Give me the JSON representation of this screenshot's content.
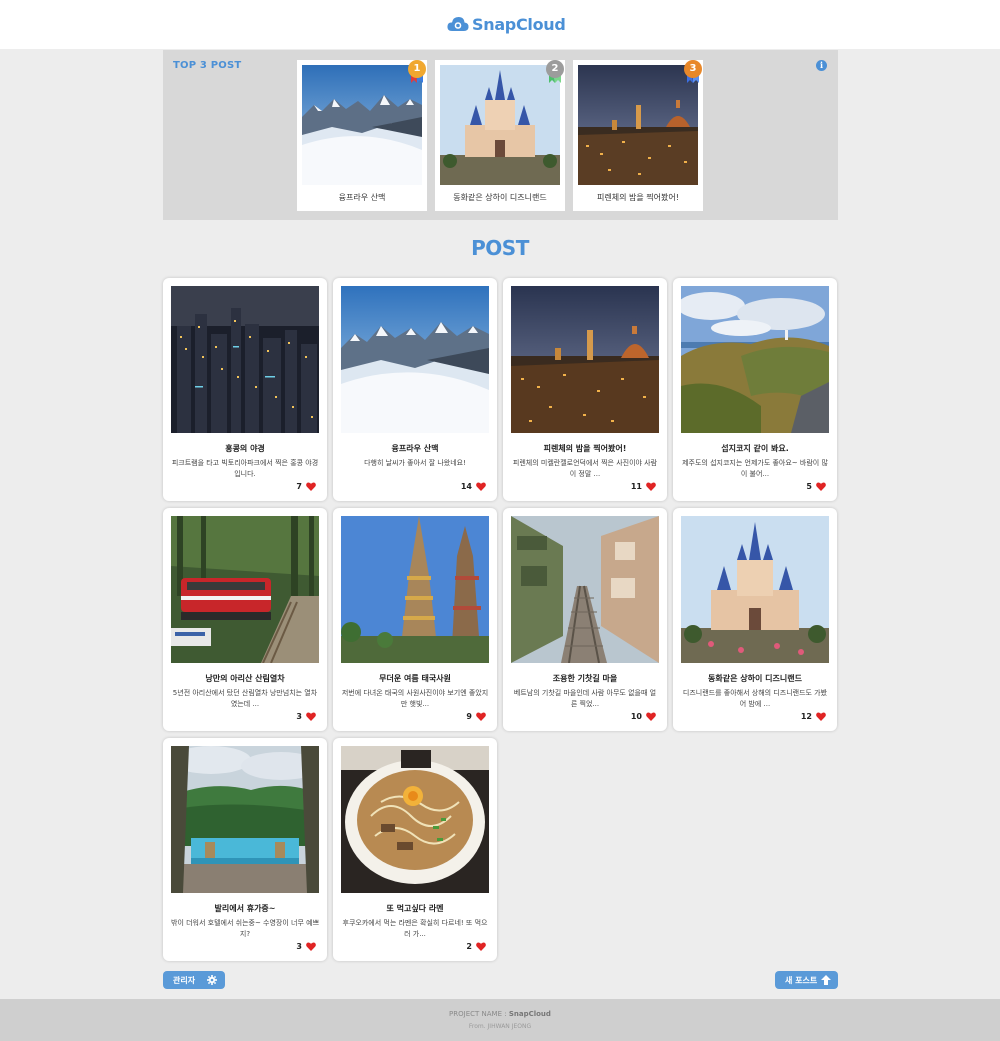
{
  "app": {
    "brand": "SnapCloud",
    "brand_color": "#4b90d6",
    "logo_icon": "cloud-camera-icon"
  },
  "top3": {
    "title": "TOP 3 POST",
    "info_icon": "info-icon",
    "posts": [
      {
        "rank": "1",
        "caption": "융프라우 산맥",
        "photo": "snowy-mountains",
        "medal_color": "#f0a830"
      },
      {
        "rank": "2",
        "caption": "동화같은 상하이 디즈니랜드",
        "photo": "disney-castle",
        "medal_color": "#9c9c9c"
      },
      {
        "rank": "3",
        "caption": "피렌체의 밤을 찍어봤어!",
        "photo": "florence-night",
        "medal_color": "#e8882a"
      }
    ]
  },
  "post_section": {
    "title": "POST"
  },
  "posts": [
    {
      "title": "홍콩의 야경",
      "desc": "피크트램을 타고 빅토리아파크에서 찍은 홍콩 야경입니다.",
      "likes": "7",
      "photo": "hongkong-night"
    },
    {
      "title": "융프라우 산맥",
      "desc": "다행히 날씨가 좋아서 잘 나왔네요!",
      "likes": "14",
      "photo": "snowy-mountains"
    },
    {
      "title": "피렌체의 밤을 찍어봤어!",
      "desc": "피렌체의 미켈란젤로언덕에서 찍은 사진이야 사람이 정말 ...",
      "likes": "11",
      "photo": "florence-night"
    },
    {
      "title": "섭지코지 같이 봐요.",
      "desc": "제주도의 섭지코지는 언제가도 좋아요~ 바람이 많이 불어...",
      "likes": "5",
      "photo": "jeju-cliff"
    },
    {
      "title": "낭만의 아리산 산림열차",
      "desc": "5년전 아리산에서 탔던 산림열차 낭만넘치는 열차였는데 ...",
      "likes": "3",
      "photo": "red-train"
    },
    {
      "title": "무더운 여름 태국사원",
      "desc": "저번에 다녀온 태국의 사원사진이야 보기엔 좋았지만 햇빛...",
      "likes": "9",
      "photo": "thai-temple"
    },
    {
      "title": "조용한 기찻길 마을",
      "desc": "베트남의 기찻길 마을인데 사람 아무도 없을때 얼른 찍었...",
      "likes": "10",
      "photo": "train-street"
    },
    {
      "title": "동화같은 상하이 디즈니랜드",
      "desc": "디즈니랜드를 좋아해서 상해의 디즈니랜드도 가봤어 밤에 ...",
      "likes": "12",
      "photo": "disney-castle"
    },
    {
      "title": "발리에서 휴가중~",
      "desc": "밖이 더워서 호텔에서 쉬는중~ 수영장이 너무 예쁘지?",
      "likes": "3",
      "photo": "bali-pool"
    },
    {
      "title": "또 먹고싶다 라멘",
      "desc": "후쿠오카에서 먹는 라멘은 확실히 다르네! 또 먹으러 가...",
      "likes": "2",
      "photo": "ramen"
    }
  ],
  "like_icon": "heart-icon",
  "like_color": "#e02424",
  "buttons": {
    "admin_label": "관리자",
    "admin_icon": "gear-icon",
    "new_post_label": "새 포스트",
    "new_post_icon": "arrow-up-icon",
    "button_color": "#5a9ad8"
  },
  "footer": {
    "project_label": "PROJECT NAME :",
    "project_name": "SnapCloud",
    "author": "From. JIHWAN JEONG"
  }
}
